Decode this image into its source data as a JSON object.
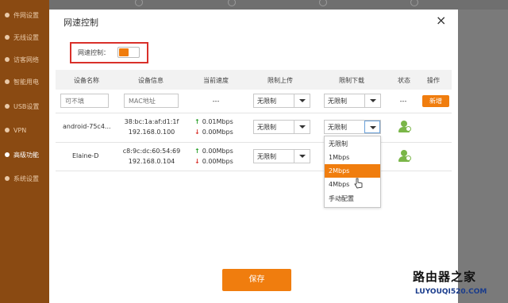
{
  "sidebar": {
    "items": [
      {
        "label": "件网设置"
      },
      {
        "label": "无线设置"
      },
      {
        "label": "访客网络"
      },
      {
        "label": "智能用电"
      },
      {
        "label": "USB设置"
      },
      {
        "label": "VPN"
      },
      {
        "label": "高级功能"
      },
      {
        "label": "系统设置"
      }
    ]
  },
  "modal": {
    "title": "网速控制",
    "close_icon": "close-icon",
    "speed_control_label": "网速控制：",
    "speed_control_on": true,
    "accent": "#f07d0e",
    "highlight": "#d9302a"
  },
  "table": {
    "headers": [
      "设备名称",
      "设备信息",
      "当前速度",
      "限制上传",
      "限制下载",
      "状态",
      "操作"
    ],
    "new_row": {
      "name_placeholder": "可不填",
      "mac_placeholder": "MAC地址",
      "speed": "---",
      "upload": "无限制",
      "download": "无限制",
      "status": "---",
      "action": "新增"
    },
    "rows": [
      {
        "name": "android-75c4...",
        "mac": "38:bc:1a:af:d1:1f",
        "ip": "192.168.0.100",
        "up": "0.01Mbps",
        "down": "0.00Mbps",
        "upload": "无限制",
        "download": "无限制",
        "status_icon": "user-icon"
      },
      {
        "name": "Elaine-D",
        "mac": "c8:9c:dc:60:54:69",
        "ip": "192.168.0.104",
        "up": "0.00Mbps",
        "down": "0.00Mbps",
        "upload": "无限制",
        "download": "",
        "status_icon": "user-icon"
      }
    ]
  },
  "dropdown": {
    "options": [
      "无限制",
      "1Mbps",
      "2Mbps",
      "4Mbps",
      "手动配置"
    ],
    "selected": "2Mbps"
  },
  "save_label": "保存",
  "watermark": {
    "text": "路由器之家",
    "url": "LUYOUQI520.COM"
  }
}
